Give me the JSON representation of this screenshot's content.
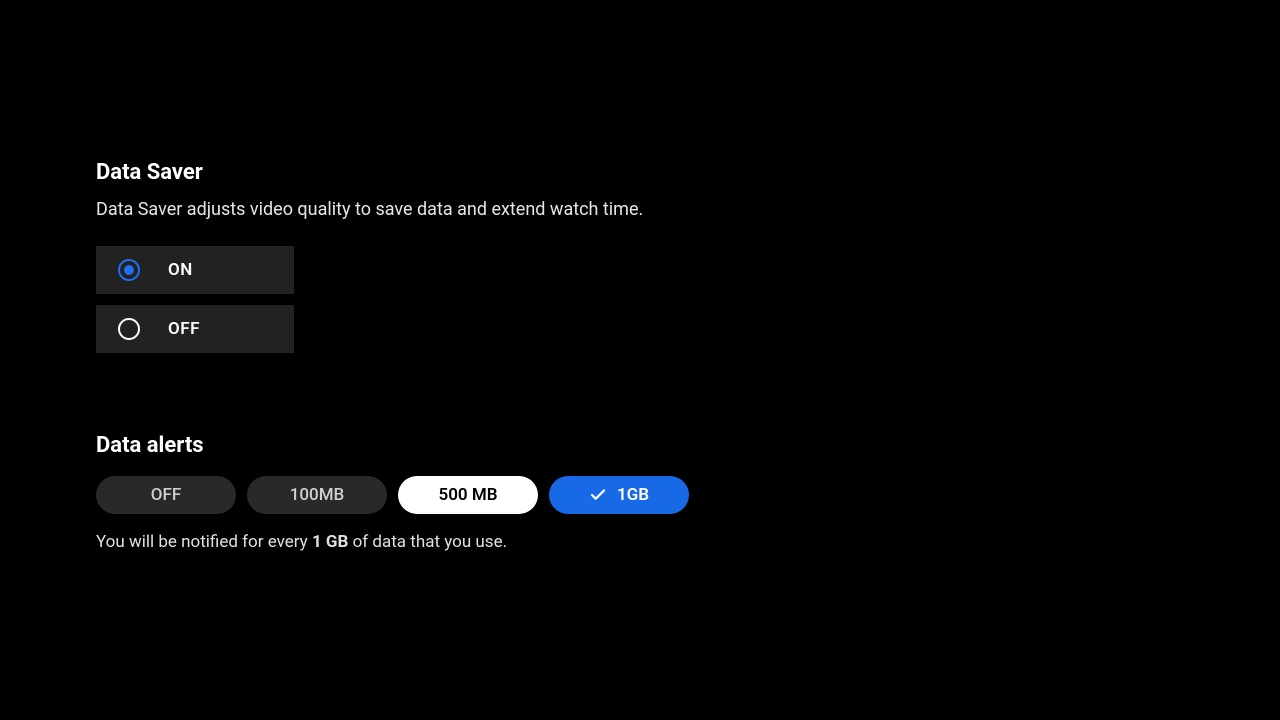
{
  "dataSaver": {
    "title": "Data Saver",
    "description": "Data Saver adjusts video quality to save data and extend watch time.",
    "options": {
      "on": "ON",
      "off": "OFF"
    },
    "selected": "on"
  },
  "dataAlerts": {
    "title": "Data alerts",
    "options": {
      "off": "OFF",
      "100mb": "100MB",
      "500mb": "500 MB",
      "1gb": "1GB"
    },
    "selected": "1gb",
    "focused": "500mb",
    "note_prefix": "You will be notified for every ",
    "note_bold": "1 GB",
    "note_suffix": " of data that you use."
  }
}
